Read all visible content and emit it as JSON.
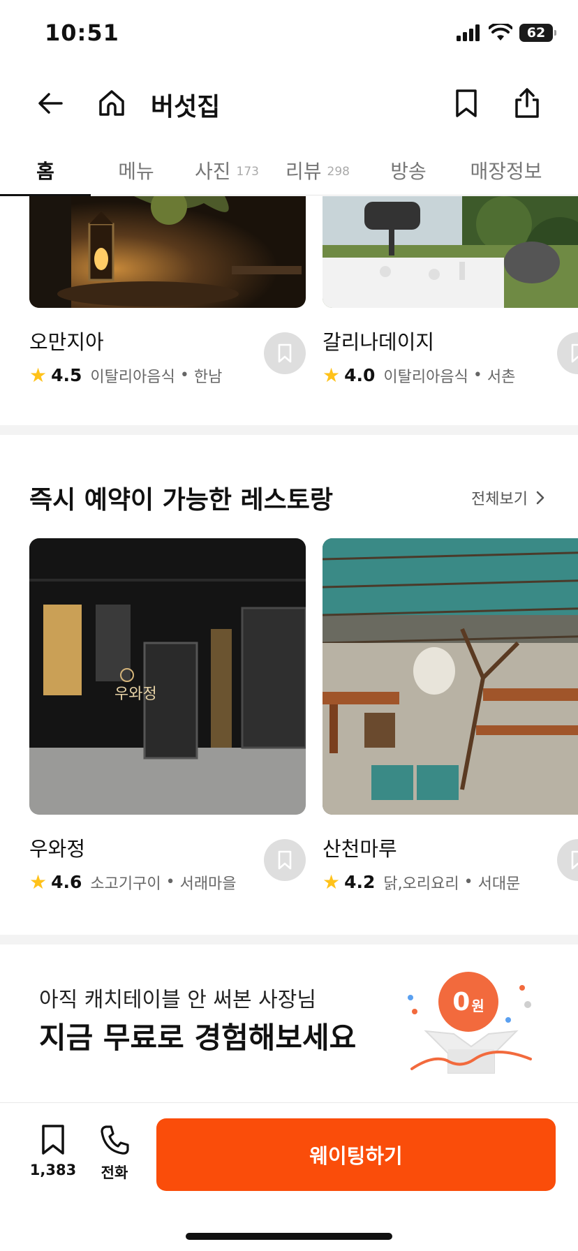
{
  "status": {
    "time": "10:51",
    "battery": "62"
  },
  "header": {
    "title": "버섯집"
  },
  "tabs": [
    {
      "label": "홈",
      "count": ""
    },
    {
      "label": "메뉴",
      "count": ""
    },
    {
      "label": "사진",
      "count": "173"
    },
    {
      "label": "리뷰",
      "count": "298"
    },
    {
      "label": "방송",
      "count": ""
    },
    {
      "label": "매장정보",
      "count": ""
    }
  ],
  "top_row": [
    {
      "name": "오만지아",
      "rating": "4.5",
      "category": "이탈리아음식",
      "area": "한남"
    },
    {
      "name": "갈리나데이지",
      "rating": "4.0",
      "category": "이탈리아음식",
      "area": "서촌"
    }
  ],
  "instant": {
    "title": "즉시 예약이 가능한 레스토랑",
    "see_all": "전체보기",
    "items": [
      {
        "name": "우와정",
        "rating": "4.6",
        "category": "소고기구이",
        "area": "서래마을",
        "sign": "우와정"
      },
      {
        "name": "산천마루",
        "rating": "4.2",
        "category": "닭,오리요리",
        "area": "서대문"
      }
    ]
  },
  "promo": {
    "subtitle": "아직 캐치테이블 안 써본 사장님",
    "title": "지금 무료로 경험해보세요",
    "badge_number": "0",
    "badge_unit": "원"
  },
  "bottom": {
    "bookmark_count": "1,383",
    "call_label": "전화",
    "cta_label": "웨이팅하기"
  },
  "colors": {
    "accent": "#fa4d0a",
    "star": "#ffc21a"
  }
}
